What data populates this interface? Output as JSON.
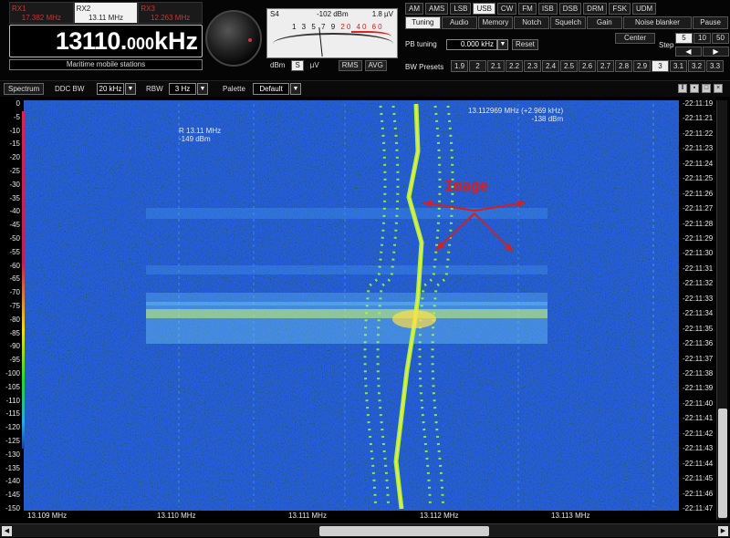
{
  "receivers": [
    {
      "name": "RX1",
      "freq": "17.382 MHz"
    },
    {
      "name": "RX2",
      "freq": "13.11 MHz"
    },
    {
      "name": "RX3",
      "freq": "12.263 MHz"
    }
  ],
  "frequency": {
    "main": "13110.",
    "sub": "000",
    "unit": "kHz"
  },
  "station": "Maritime mobile stations",
  "smeter": {
    "s_label": "S4",
    "dbm": "-102 dBm",
    "uv": "1.8 µV",
    "scale_black": "1 3 5 7 9",
    "scale_red": "20 40 60",
    "units": [
      "dBm",
      "S",
      "µV"
    ],
    "selected_unit": "S",
    "modes": [
      "RMS",
      "AVG"
    ]
  },
  "modes": [
    "AM",
    "AMS",
    "LSB",
    "USB",
    "CW",
    "FM",
    "ISB",
    "DSB",
    "DRM",
    "FSK",
    "UDM"
  ],
  "selected_mode": "USB",
  "panel_tabs": [
    "Tuning",
    "Audio",
    "Memory",
    "Notch",
    "Squelch",
    "Gain",
    "Noise blanker",
    "Pause"
  ],
  "selected_tab": "Tuning",
  "pb_tuning": {
    "label": "PB tuning",
    "value": "0.000 kHz",
    "reset": "Reset"
  },
  "center_label": "Center",
  "step": {
    "label": "Step",
    "options": [
      "5",
      "10",
      "50"
    ],
    "selected": "5"
  },
  "bw_presets": {
    "label": "BW Presets",
    "options": [
      "1.9",
      "2",
      "2.1",
      "2.2",
      "2.3",
      "2.4",
      "2.5",
      "2.6",
      "2.7",
      "2.8",
      "2.9",
      "3",
      "3.1",
      "3.2",
      "3.3"
    ],
    "selected": "3"
  },
  "toolbar": {
    "spectrum": "Spectrum",
    "ddc_bw_label": "DDC BW",
    "ddc_bw_value": "20 kHz",
    "rbw_label": "RBW",
    "rbw_value": "3 Hz",
    "palette_label": "Palette",
    "palette_value": "Default"
  },
  "waterfall": {
    "db_ticks": [
      "0",
      "-5",
      "-10",
      "-15",
      "-20",
      "-25",
      "-30",
      "-35",
      "-40",
      "-45",
      "-50",
      "-55",
      "-60",
      "-65",
      "-70",
      "-75",
      "-80",
      "-85",
      "-90",
      "-95",
      "-100",
      "-105",
      "-110",
      "-115",
      "-120",
      "-125",
      "-130",
      "-135",
      "-140",
      "-145",
      "-150"
    ],
    "time_ticks": [
      "22:11:19",
      "22:11:21",
      "22:11:22",
      "22:11:23",
      "22:11:24",
      "22:11:25",
      "22:11:26",
      "22:11:27",
      "22:11:28",
      "22:11:29",
      "22:11:30",
      "22:11:31",
      "22:11:32",
      "22:11:33",
      "22:11:34",
      "22:11:35",
      "22:11:36",
      "22:11:37",
      "22:11:38",
      "22:11:39",
      "22:11:40",
      "22:11:41",
      "22:11:42",
      "22:11:43",
      "22:11:44",
      "22:11:45",
      "22:11:46",
      "22:11:47"
    ],
    "freq_ticks": [
      "13.109 MHz",
      "13.110 MHz",
      "13.111 MHz",
      "13.112 MHz",
      "13.113 MHz"
    ],
    "marker_r": {
      "line1": "R 13.11 MHz",
      "line2": "-149 dBm"
    },
    "marker_cursor": {
      "line1": "13.112969 MHz (+2.969 kHz)",
      "line2": "-138 dBm"
    },
    "annotation": "Image",
    "colors": {
      "background": "#000000",
      "noise": "#0a2a6e",
      "signal": "#9eff3a",
      "peak": "#ffe04a",
      "annotation": "#d61f1f"
    }
  }
}
